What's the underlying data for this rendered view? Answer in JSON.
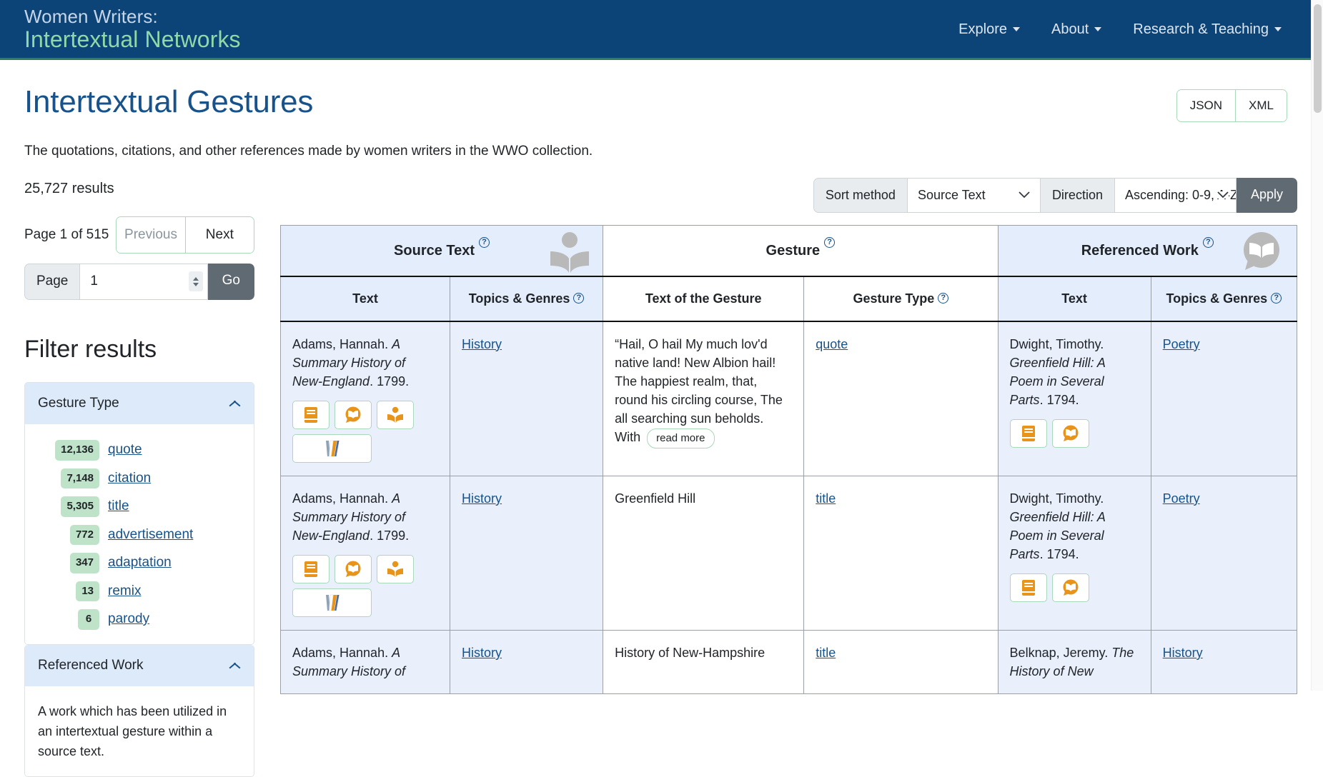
{
  "site": {
    "brand_line1": "Women Writers:",
    "brand_line2": "Intertextual Networks",
    "nav": [
      {
        "label": "Explore",
        "icon": "chevron-down-icon"
      },
      {
        "label": "About",
        "icon": "chevron-down-icon"
      },
      {
        "label": "Research & Teaching",
        "icon": "chevron-down-icon"
      }
    ]
  },
  "page": {
    "title": "Intertextual Gestures",
    "subtitle": "The quotations, citations, and other references made by women writers in the WWO collection.",
    "formats": [
      "JSON",
      "XML"
    ]
  },
  "sidebar": {
    "results_count": "25,727 results",
    "page_of": "Page 1 of 515",
    "previous_label": "Previous",
    "next_label": "Next",
    "page_label": "Page",
    "page_value": "1",
    "go_label": "Go",
    "filter_title": "Filter results",
    "facets": [
      {
        "name": "Gesture Type",
        "collapse_icon": "chevron-up-icon",
        "items": [
          {
            "count": "12,136",
            "label": "quote"
          },
          {
            "count": "7,148",
            "label": "citation"
          },
          {
            "count": "5,305",
            "label": "title"
          },
          {
            "count": "772",
            "label": "advertisement"
          },
          {
            "count": "347",
            "label": "adaptation"
          },
          {
            "count": "13",
            "label": "remix"
          },
          {
            "count": "6",
            "label": "parody"
          }
        ]
      },
      {
        "name": "Referenced Work",
        "collapse_icon": "chevron-up-icon",
        "description": "A work which has been utilized in an intertextual gesture within a source text."
      }
    ]
  },
  "sort_bar": {
    "sort_method_label": "Sort method",
    "sort_method_value": "Source Text",
    "direction_label": "Direction",
    "direction_value": "Ascending: 0-9, A-Z",
    "apply_label": "Apply"
  },
  "table": {
    "groups": [
      {
        "label": "Source Text",
        "help": "?",
        "icon": "person-reading-book-icon",
        "shaded": true
      },
      {
        "label": "Gesture",
        "help": "?",
        "icon": "",
        "shaded": false
      },
      {
        "label": "Referenced Work",
        "help": "?",
        "icon": "book-speech-bubble-icon",
        "shaded": true
      }
    ],
    "columns": [
      {
        "label": "Text",
        "help": "",
        "shaded": true
      },
      {
        "label": "Topics & Genres",
        "help": "?",
        "shaded": true
      },
      {
        "label": "Text of the Gesture",
        "help": "",
        "shaded": false
      },
      {
        "label": "Gesture Type",
        "help": "?",
        "shaded": false
      },
      {
        "label": "Text",
        "help": "",
        "shaded": true
      },
      {
        "label": "Topics & Genres",
        "help": "?",
        "shaded": true
      }
    ],
    "read_more_label": "read more",
    "rows": [
      {
        "source_author": "Adams, Hannah. ",
        "source_title": "A Summary History of New-England",
        "source_date": ". 1799.",
        "source_icons": [
          "book-icon",
          "book-speech-bubble-icon",
          "person-reading-book-icon",
          "wwo-logo-icon"
        ],
        "source_topics": "History",
        "gesture_text": "“Hail, O hail My much lov'd native land! New Albion hail! The happiest realm, that, round his circling course, The all searching sun beholds. With",
        "gesture_truncated": true,
        "gesture_type": "quote",
        "ref_author": "Dwight, Timothy. ",
        "ref_title": "Greenfield Hill: A Poem in Several Parts",
        "ref_date": ". 1794.",
        "ref_icons": [
          "book-icon",
          "book-speech-bubble-icon"
        ],
        "ref_topics": "Poetry"
      },
      {
        "source_author": "Adams, Hannah. ",
        "source_title": "A Summary History of New-England",
        "source_date": ". 1799.",
        "source_icons": [
          "book-icon",
          "book-speech-bubble-icon",
          "person-reading-book-icon",
          "wwo-logo-icon"
        ],
        "source_topics": "History",
        "gesture_text": "Greenfield Hill",
        "gesture_truncated": false,
        "gesture_type": "title",
        "ref_author": "Dwight, Timothy. ",
        "ref_title": "Greenfield Hill: A Poem in Several Parts",
        "ref_date": ". 1794.",
        "ref_icons": [
          "book-icon",
          "book-speech-bubble-icon"
        ],
        "ref_topics": "Poetry"
      },
      {
        "source_author": "Adams, Hannah. ",
        "source_title": "A Summary History of",
        "source_date": "",
        "source_icons": [],
        "source_topics": "History",
        "gesture_text": "History of New-Hampshire",
        "gesture_truncated": false,
        "gesture_type": "title",
        "ref_author": "Belknap, Jeremy. ",
        "ref_title": "The History of New",
        "ref_date": "",
        "ref_icons": [],
        "ref_topics": "History"
      }
    ]
  },
  "colors": {
    "navy": "#0d4477",
    "green_accent": "#8fd9a8",
    "link": "#17538a",
    "header_shade": "#e4edfb",
    "badge": "#bfe3c8",
    "icon_orange": "#e8941a"
  }
}
